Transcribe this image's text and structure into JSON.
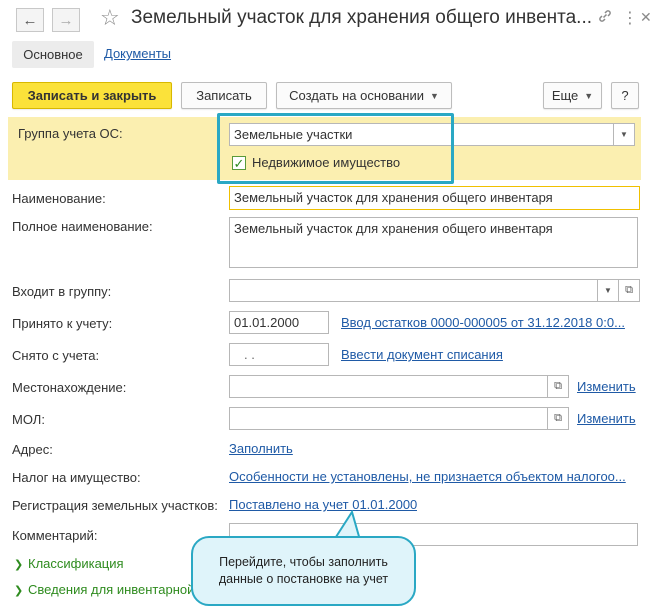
{
  "header": {
    "title": "Земельный участок для хранения общего инвента...",
    "back_icon": "←",
    "forward_icon": "→",
    "star_icon": "☆",
    "link_icon": "🔗",
    "more_icon": "⋮",
    "close_icon": "✕"
  },
  "tabs": {
    "main": "Основное",
    "documents": "Документы"
  },
  "toolbar": {
    "save_close": "Записать и закрыть",
    "save": "Записать",
    "create_based": "Создать на основании",
    "more": "Еще",
    "help": "?"
  },
  "form": {
    "group_label": "Группа учета ОС:",
    "group_value": "Земельные участки",
    "realty_checkbox": "Недвижимое имущество",
    "realty_checked": true,
    "name_label": "Наименование:",
    "name_value": "Земельный участок для хранения общего инвентаря",
    "full_name_label": "Полное наименование:",
    "full_name_value": "Земельный участок для хранения общего инвентаря",
    "parent_label": "Входит в группу:",
    "parent_value": "",
    "accepted_label": "Принято к учету:",
    "accepted_date": "01.01.2000",
    "accepted_doc_link": "Ввод остатков 0000-000005 от 31.12.2018 0:0...",
    "removed_label": "Снято с учета:",
    "removed_date": ".  .",
    "removed_doc_link": "Ввести документ списания",
    "location_label": "Местонахождение:",
    "location_value": "",
    "location_change": "Изменить",
    "mol_label": "МОЛ:",
    "mol_value": "",
    "mol_change": "Изменить",
    "address_label": "Адрес:",
    "address_fill": "Заполнить",
    "tax_label": "Налог на имущество:",
    "tax_link": "Особенности не установлены, не признается объектом налогоо...",
    "land_reg_label": "Регистрация земельных участков:",
    "land_reg_link": "Поставлено на учет 01.01.2000",
    "comment_label": "Комментарий:",
    "comment_value": "",
    "section_classification": "Классификация",
    "section_inventory": "Сведения для инвентарной карточки"
  },
  "tooltip": {
    "text": "Перейдите, чтобы заполнить данные о постановке на учет"
  },
  "colors": {
    "primary_button": "#fbe23a",
    "group_highlight": "#fbefb0",
    "callout_border": "#2aa8c4",
    "callout_fill": "#dff4fa",
    "link": "#1f5aa6",
    "expander": "#2e8b1e"
  }
}
